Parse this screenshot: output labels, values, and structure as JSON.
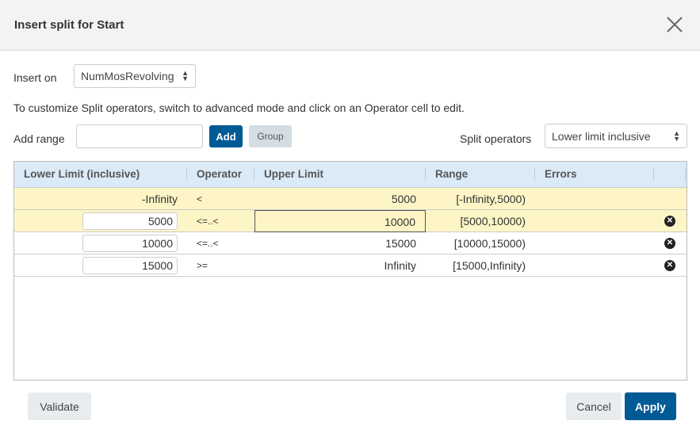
{
  "dialog": {
    "title": "Insert split for Start"
  },
  "insert_on": {
    "label": "Insert on",
    "value": "NumMosRevolving"
  },
  "hint": "To customize Split operators, switch to advanced mode and click on an Operator cell to edit.",
  "add_range": {
    "label": "Add range",
    "value": "",
    "add_label": "Add",
    "group_label": "Group"
  },
  "split_operators": {
    "label": "Split operators",
    "value": "Lower limit inclusive"
  },
  "table": {
    "headers": [
      "Lower Limit (inclusive)",
      "Operator",
      "Upper Limit",
      "Range",
      "Errors"
    ],
    "rows": [
      {
        "lower": "-Infinity",
        "operator": "<",
        "upper": "5000",
        "range": "[-Infinity,5000)",
        "errors": ""
      },
      {
        "lower": "5000",
        "operator": "<=..<",
        "upper": "10000",
        "range": "[5000,10000)",
        "errors": ""
      },
      {
        "lower": "10000",
        "operator": "<=..<",
        "upper": "15000",
        "range": "[10000,15000)",
        "errors": ""
      },
      {
        "lower": "15000",
        "operator": ">=",
        "upper": "Infinity",
        "range": "[15000,Infinity)",
        "errors": ""
      }
    ]
  },
  "footer": {
    "validate": "Validate",
    "cancel": "Cancel",
    "apply": "Apply"
  },
  "colors": {
    "primary": "#005a96",
    "header_bg": "#dbeaf7",
    "highlight": "#fdf5c5"
  }
}
